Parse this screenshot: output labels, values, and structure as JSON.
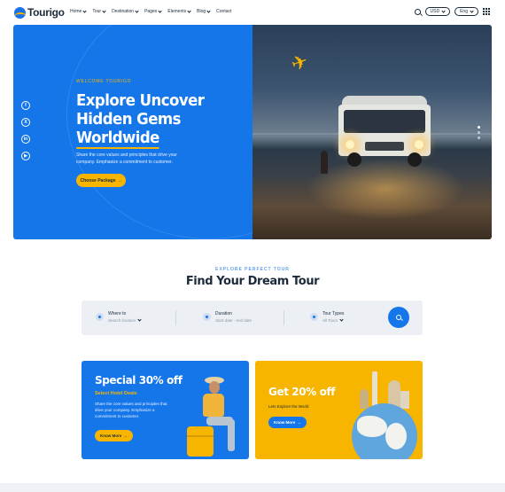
{
  "header": {
    "logo_text": "Tourigo",
    "nav": [
      "Home",
      "Tour",
      "Destination",
      "Pages",
      "Elements",
      "Blog",
      "Contact"
    ],
    "currency": "USD",
    "language": "Eng"
  },
  "hero": {
    "eyebrow": "WELCOME TOURIGO",
    "title_line1": "Explore Uncover",
    "title_line2": "Hidden Gems",
    "title_line3": "Worldwide",
    "description": "Share the core values and principles that drive your company. Emphasize a commitment to customer.",
    "button_label": "Choose Package",
    "socials": [
      "f",
      "X",
      "in",
      "▶"
    ],
    "slider_dots": 3
  },
  "find_tour": {
    "eyebrow": "EXPLORE PERFECT TOUR",
    "title": "Find Your Dream Tour",
    "where_label": "Where to",
    "where_value": "Search location",
    "duration_label": "Duration",
    "duration_value": "Start date - end date",
    "types_label": "Tour Types",
    "types_value": "All Tours"
  },
  "offers": [
    {
      "title": "Special 30% off",
      "subtitle": "Select Hotel Deals",
      "description": "Share the core values and principles that drive your company. Emphasize a commitment to customer.",
      "button_label": "Know More"
    },
    {
      "title": "Get 20% off",
      "subtitle": "Lets Explore the World",
      "button_label": "Know More"
    }
  ],
  "colors": {
    "primary": "#1576e9",
    "accent": "#f7b500",
    "text": "#1b2a3a"
  }
}
